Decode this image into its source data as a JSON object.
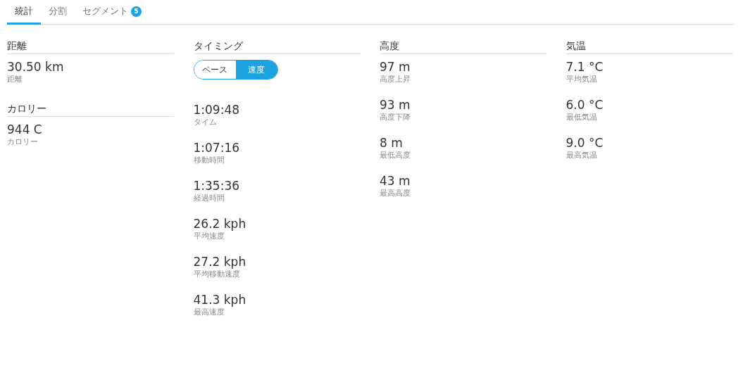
{
  "tabs": [
    {
      "label": "統計",
      "selected": true
    },
    {
      "label": "分割",
      "selected": false
    },
    {
      "label": "セグメント",
      "selected": false,
      "badge": "5"
    }
  ],
  "columns": [
    {
      "sections": [
        {
          "title": "距離",
          "stats": [
            {
              "value": "30.50 km",
              "label": "距離"
            }
          ]
        },
        {
          "title": "カロリー",
          "stats": [
            {
              "value": "944 C",
              "label": "カロリー"
            }
          ]
        }
      ]
    },
    {
      "sections": [
        {
          "title": "タイミング",
          "toggle": [
            {
              "label": "ペース",
              "selected": false
            },
            {
              "label": "速度",
              "selected": true
            }
          ],
          "stats": [
            {
              "value": "1:09:48",
              "label": "タイム"
            },
            {
              "value": "1:07:16",
              "label": "移動時間"
            },
            {
              "value": "1:35:36",
              "label": "経過時間"
            },
            {
              "value": "26.2 kph",
              "label": "平均速度"
            },
            {
              "value": "27.2 kph",
              "label": "平均移動速度"
            },
            {
              "value": "41.3 kph",
              "label": "最高速度"
            }
          ]
        }
      ]
    },
    {
      "sections": [
        {
          "title": "高度",
          "stats": [
            {
              "value": "97 m",
              "label": "高度上昇"
            },
            {
              "value": "93 m",
              "label": "高度下降"
            },
            {
              "value": "8 m",
              "label": "最低高度"
            },
            {
              "value": "43 m",
              "label": "最高高度"
            }
          ]
        }
      ]
    },
    {
      "sections": [
        {
          "title": "気温",
          "stats": [
            {
              "value": "7.1 °C",
              "label": "平均気温"
            },
            {
              "value": "6.0 °C",
              "label": "最低気温"
            },
            {
              "value": "9.0 °C",
              "label": "最高気温"
            }
          ]
        }
      ]
    }
  ]
}
